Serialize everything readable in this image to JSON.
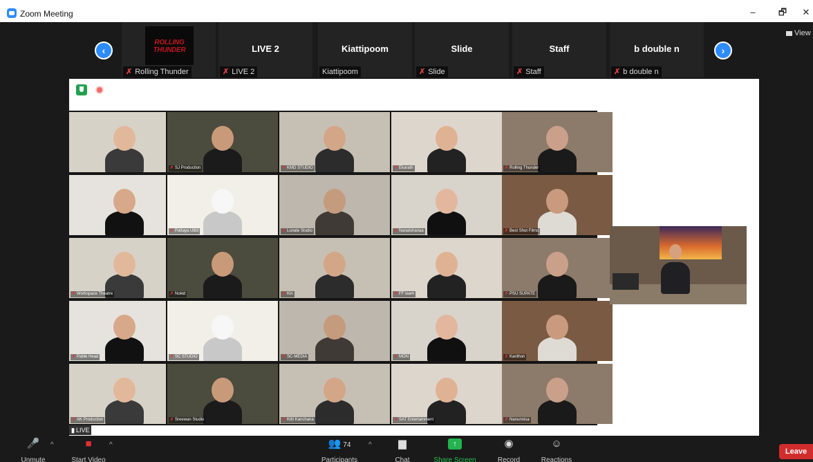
{
  "window": {
    "title": "Zoom Meeting",
    "min_label": "–",
    "restore_label": "🗗",
    "close_label": "✕"
  },
  "strip": {
    "prev_icon": "chevron-left-icon",
    "next_icon": "chevron-right-icon",
    "prev_glyph": "‹",
    "next_glyph": "›",
    "tiles": [
      {
        "name": "",
        "label": "Rolling Thunder",
        "muted": true,
        "logo_line1": "ROLLING",
        "logo_line2": "THUNDER"
      },
      {
        "name": "LIVE 2",
        "label": "LIVE 2",
        "muted": true
      },
      {
        "name": "Kiattipoom",
        "label": "Kiattipoom",
        "muted": false
      },
      {
        "name": "Slide",
        "label": "Slide",
        "muted": true
      },
      {
        "name": "Staff",
        "label": "Staff",
        "muted": true
      },
      {
        "name": "b double n",
        "label": "b double n",
        "muted": true
      }
    ],
    "view_label": "View"
  },
  "share": {
    "live_badge": "LIVE",
    "grid": [
      [
        "",
        "SJ Production",
        "KMD STUDIO",
        "Ekarath",
        "Rolling Thunder"
      ],
      [
        "",
        "Pattaya Utbit",
        "Lunate Studio",
        "Nanatshanaa",
        "Best Shot Films"
      ],
      [
        "Workspace Theatre",
        "Nokid",
        "Kin",
        "FF team",
        "PSU SUPATE"
      ],
      [
        "Pable Head",
        "SC STUDIO",
        "SC-MEDIA",
        "MON",
        "Kanthon"
      ],
      [
        "AK Production",
        "Sreewan Studio",
        "Kitti Kanchana",
        "SAT Entertainment",
        "Nanunnisa"
      ]
    ]
  },
  "toolbar": {
    "unmute": "Unmute",
    "start_video": "Start Video",
    "participants": "Participants",
    "participant_count": "74",
    "chat": "Chat",
    "share_screen": "Share Screen",
    "record": "Record",
    "reactions": "Reactions",
    "leave": "Leave"
  },
  "colors": {
    "accent": "#2d8cff",
    "share_green": "#23b34f",
    "leave_red": "#d22d2d",
    "muted_red": "#e0403f"
  }
}
